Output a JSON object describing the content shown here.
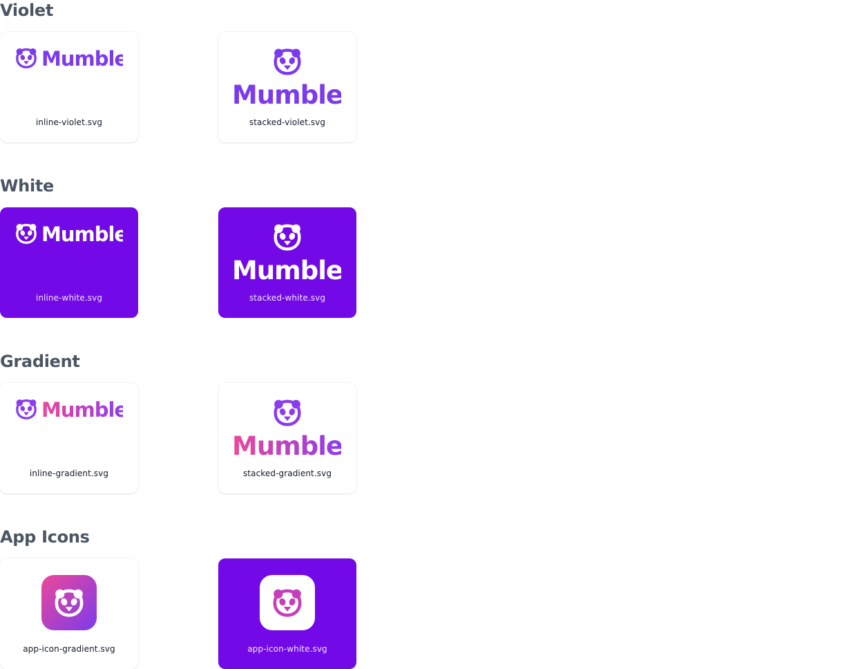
{
  "sections": [
    {
      "title": "Violet",
      "cards": [
        {
          "file": "inline-violet.svg",
          "wordmark": "Mumble",
          "style": "inline",
          "variant": "violet"
        },
        {
          "file": "stacked-violet.svg",
          "wordmark": "Mumble",
          "style": "stacked",
          "variant": "violet"
        }
      ]
    },
    {
      "title": "White",
      "cards": [
        {
          "file": "inline-white.svg",
          "wordmark": "Mumble",
          "style": "inline",
          "variant": "white"
        },
        {
          "file": "stacked-white.svg",
          "wordmark": "Mumble",
          "style": "stacked",
          "variant": "white"
        }
      ]
    },
    {
      "title": "Gradient",
      "cards": [
        {
          "file": "inline-gradient.svg",
          "wordmark": "Mumble",
          "style": "inline",
          "variant": "gradient"
        },
        {
          "file": "stacked-gradient.svg",
          "wordmark": "Mumble",
          "style": "stacked",
          "variant": "gradient"
        }
      ]
    },
    {
      "title": "App Icons",
      "cards": [
        {
          "file": "app-icon-gradient.svg",
          "style": "app-icon",
          "variant": "gradient"
        },
        {
          "file": "app-icon-white.svg",
          "style": "app-icon",
          "variant": "white"
        }
      ]
    }
  ],
  "colors": {
    "violet": "#7c3aed",
    "purple_bg": "#7209e6",
    "pink": "#ec4899",
    "heading": "#4b5563",
    "caption": "#111827"
  },
  "icons": {
    "logo_mark": "panda-icon"
  }
}
